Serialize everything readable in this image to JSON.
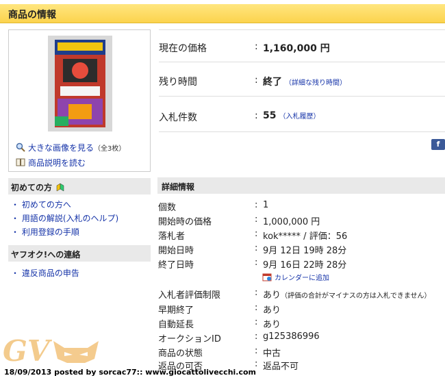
{
  "header": {
    "title": "商品の情報"
  },
  "image_panel": {
    "enlarge_label": "大きな画像を見る",
    "enlarge_count": "（全3枚）",
    "description_label": "商品説明を読む"
  },
  "sidebar": {
    "beginner_title": "初めての方",
    "beginner_items": [
      "初めての方へ",
      "用語の解説(入札のヘルプ)",
      "利用登録の手順"
    ],
    "contact_title": "ヤフオク!への連絡",
    "contact_items": [
      "違反商品の申告"
    ]
  },
  "summary": {
    "price_label": "現在の価格",
    "price_value": "1,160,000 円",
    "time_label": "残り時間",
    "time_value": "終了",
    "time_link": "（詳細な残り時間）",
    "bids_label": "入札件数",
    "bids_value": "55",
    "bids_link": "（入札履歴）",
    "colon": ":"
  },
  "details": {
    "title": "詳細情報",
    "rows": [
      {
        "label": "個数",
        "value": "1"
      },
      {
        "label": "開始時の価格",
        "value": "1,000,000 円"
      },
      {
        "label": "落札者",
        "value": "kok***** / 評価：56"
      },
      {
        "label": "開始日時",
        "value": "9月 12日 19時 28分"
      },
      {
        "label": "終了日時",
        "value": "9月 16日 22時 28分"
      },
      {
        "label": "入札者評価制限",
        "value": "あり",
        "note": "（評価の合計がマイナスの方は入札できません）"
      },
      {
        "label": "早期終了",
        "value": "あり"
      },
      {
        "label": "自動延長",
        "value": "あり"
      },
      {
        "label": "オークションID",
        "value": "g125386996"
      },
      {
        "label": "商品の状態",
        "value": "中古"
      },
      {
        "label": "返品の可否",
        "value": "返品不可"
      }
    ],
    "calendar_link": "カレンダーに追加"
  },
  "overlay": {
    "logo_text": "GV",
    "watermark": "18/09/2013 posted by sorcac77:: www.giocattolivecchi.com"
  },
  "colors": {
    "header_bg": "#fcd34d",
    "link": "#1533a8",
    "section_bg": "#e9e9e9"
  }
}
